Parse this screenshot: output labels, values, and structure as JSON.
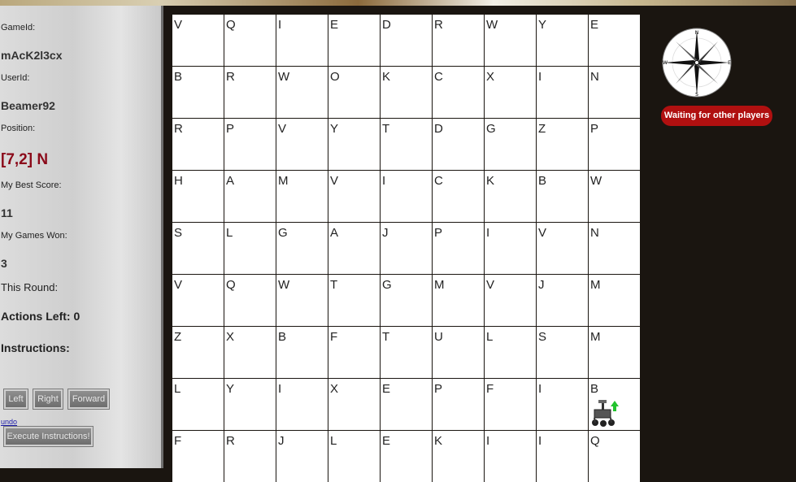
{
  "sidebar": {
    "game_id_label": "GameId:",
    "game_id": "mAcK2l3cx",
    "user_id_label": "UserId:",
    "user_id": "Beamer92",
    "position_label": "Position:",
    "position": "[7,2] N",
    "best_score_label": "My Best Score:",
    "best_score": "11",
    "games_won_label": "My Games Won:",
    "games_won": "3",
    "this_round_label": "This Round:",
    "actions_left": "Actions Left: 0",
    "instructions_label": "Instructions:",
    "buttons": {
      "left": "Left",
      "right": "Right",
      "forward": "Forward"
    },
    "undo": "undo",
    "execute": "Execute Instructions!"
  },
  "status": {
    "waiting": "Waiting for other players"
  },
  "compass": {
    "icon": "compass-rose-icon",
    "n": "N",
    "e": "E",
    "s": "S",
    "w": "W"
  },
  "board": {
    "rows": [
      [
        "V",
        "Q",
        "I",
        "E",
        "D",
        "R",
        "W",
        "Y",
        "E"
      ],
      [
        "B",
        "R",
        "W",
        "O",
        "K",
        "C",
        "X",
        "I",
        "N"
      ],
      [
        "R",
        "P",
        "V",
        "Y",
        "T",
        "D",
        "G",
        "Z",
        "P"
      ],
      [
        "H",
        "A",
        "M",
        "V",
        "I",
        "C",
        "K",
        "B",
        "W"
      ],
      [
        "S",
        "L",
        "G",
        "A",
        "J",
        "P",
        "I",
        "V",
        "N"
      ],
      [
        "V",
        "Q",
        "W",
        "T",
        "G",
        "M",
        "V",
        "J",
        "M"
      ],
      [
        "Z",
        "X",
        "B",
        "F",
        "T",
        "U",
        "L",
        "S",
        "M"
      ],
      [
        "L",
        "Y",
        "I",
        "X",
        "E",
        "P",
        "F",
        "I",
        "B"
      ],
      [
        "F",
        "R",
        "J",
        "L",
        "E",
        "K",
        "I",
        "I",
        "Q"
      ]
    ],
    "rover": {
      "icon": "rover-icon",
      "row": 7,
      "col": 8,
      "heading": "N"
    }
  }
}
